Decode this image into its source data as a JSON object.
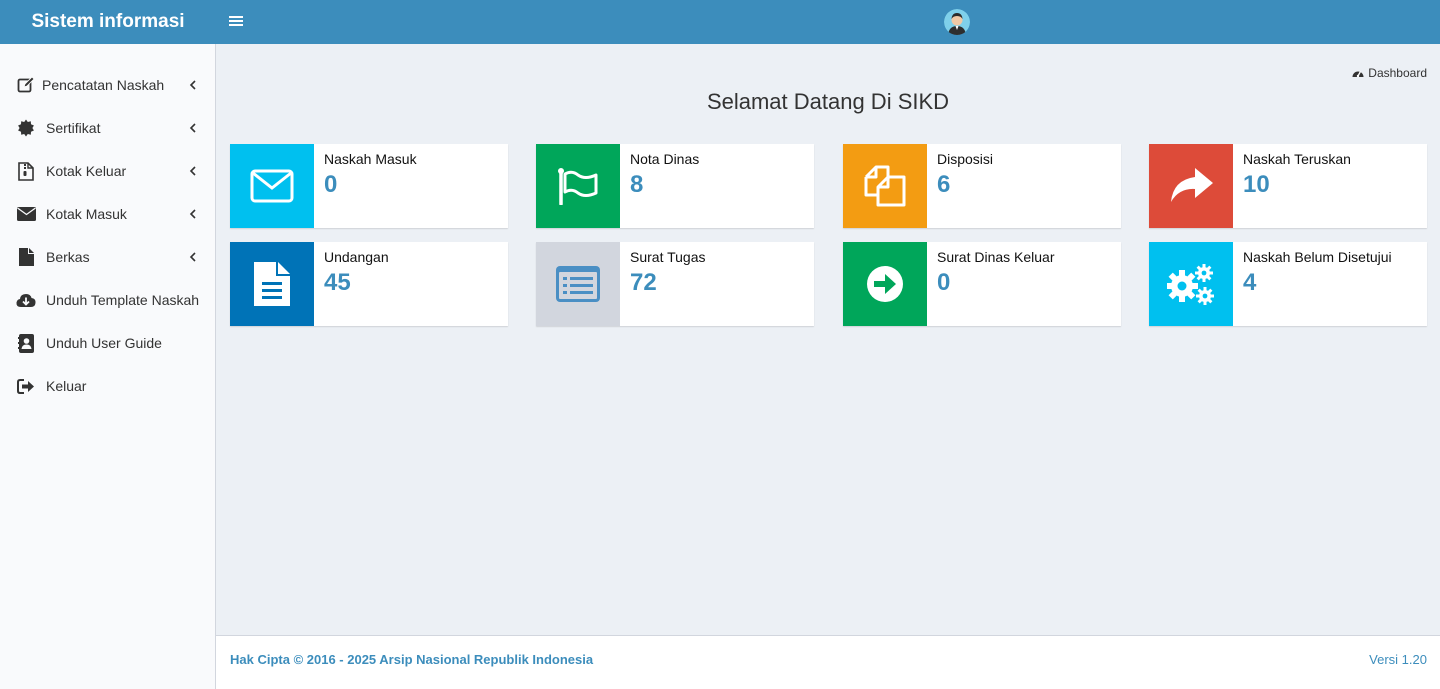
{
  "header": {
    "brand": "Sistem informasi",
    "icons": {
      "menu": "hamburger-icon",
      "avatar": "user-avatar"
    }
  },
  "sidebar": {
    "items": [
      {
        "label": "Pencatatan Naskah",
        "icon": "edit-icon",
        "has_submenu": true
      },
      {
        "label": "Sertifikat",
        "icon": "certificate-icon",
        "has_submenu": true
      },
      {
        "label": "Kotak Keluar",
        "icon": "file-archive-icon",
        "has_submenu": true
      },
      {
        "label": "Kotak Masuk",
        "icon": "envelope-icon",
        "has_submenu": true
      },
      {
        "label": "Berkas",
        "icon": "file-icon",
        "has_submenu": true
      },
      {
        "label": "Unduh Template Naskah",
        "icon": "cloud-download-icon",
        "has_submenu": false
      },
      {
        "label": "Unduh User Guide",
        "icon": "address-book-icon",
        "has_submenu": false
      },
      {
        "label": "Keluar",
        "icon": "sign-out-icon",
        "has_submenu": false
      }
    ]
  },
  "breadcrumb": {
    "label": "Dashboard",
    "icon": "dashboard-icon"
  },
  "main": {
    "title": "Selamat Datang Di SIKD",
    "cards": [
      {
        "label": "Naskah Masuk",
        "count": "0",
        "color": "#00c0ef",
        "icon": "envelope-icon"
      },
      {
        "label": "Nota Dinas",
        "count": "8",
        "color": "#00a65a",
        "icon": "flag-icon"
      },
      {
        "label": "Disposisi",
        "count": "6",
        "color": "#f39c12",
        "icon": "copy-icon"
      },
      {
        "label": "Naskah Teruskan",
        "count": "10",
        "color": "#dd4b39",
        "icon": "share-icon"
      },
      {
        "label": "Undangan",
        "count": "45",
        "color": "#0073b7",
        "icon": "file-text-icon"
      },
      {
        "label": "Surat Tugas",
        "count": "72",
        "color": "#d2d6de",
        "icon": "list-alt-icon"
      },
      {
        "label": "Surat Dinas Keluar",
        "count": "0",
        "color": "#00a65a",
        "icon": "arrow-circle-right-icon"
      },
      {
        "label": "Naskah Belum Disetujui",
        "count": "4",
        "color": "#00c0ef",
        "icon": "cogs-icon"
      }
    ]
  },
  "footer": {
    "copyright": "Hak Cipta © 2016 - 2025 Arsip Nasional Republik Indonesia",
    "version": "Versi 1.20"
  },
  "colors": {
    "primary": "#3c8dbc",
    "background": "#ecf0f5"
  }
}
